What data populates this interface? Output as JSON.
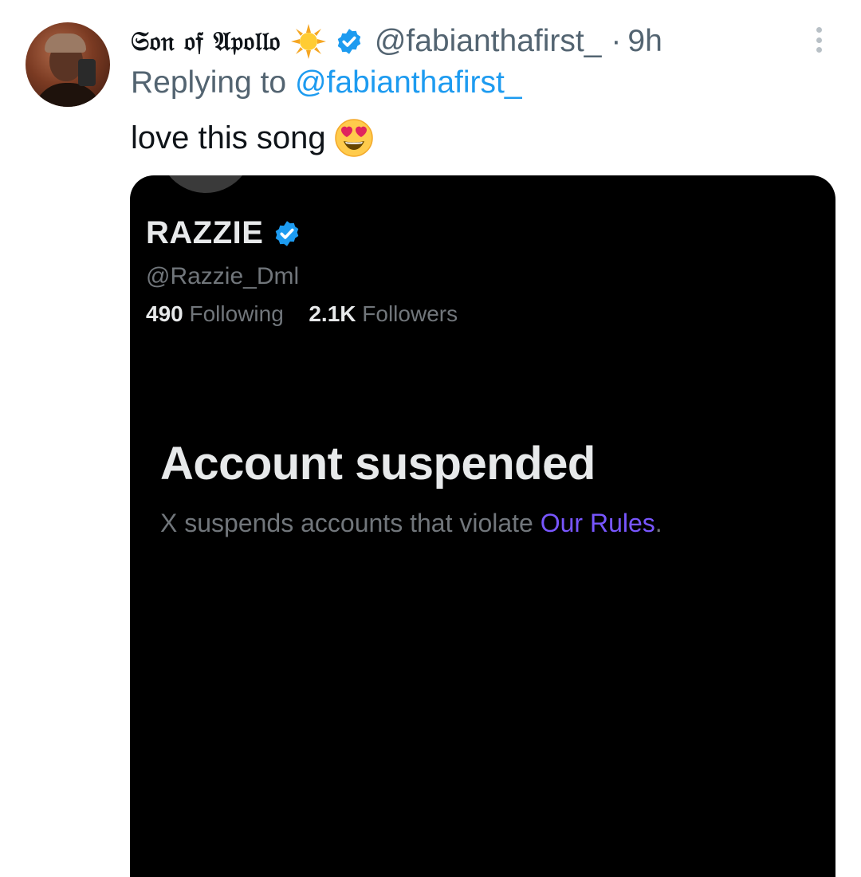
{
  "tweet": {
    "display_name": "𝔖𝔬𝔫 𝔬𝔣 𝔄𝔭𝔬𝔩𝔩𝔬",
    "handle": "@fabianthafirst_",
    "separator": "·",
    "timestamp": "9h",
    "reply_prefix": "Replying to ",
    "reply_to": "@fabianthafirst_",
    "text": "love this song",
    "icons": [
      "sun-emoji",
      "verified-badge",
      "more-options",
      "heart-eyes-emoji"
    ]
  },
  "embedded_profile": {
    "name": "RAZZIE",
    "handle": "@Razzie_Dml",
    "following_count": "490",
    "following_label": "Following",
    "followers_count": "2.1K",
    "followers_label": "Followers",
    "suspended_title": "Account suspended",
    "suspended_text": "X suspends accounts that violate ",
    "rules_link": "Our Rules",
    "suspended_end": "."
  },
  "colors": {
    "accent": "#1d9bf0",
    "rules_link": "#7856ff",
    "secondary_text": "#536471",
    "media_bg": "#000000"
  }
}
